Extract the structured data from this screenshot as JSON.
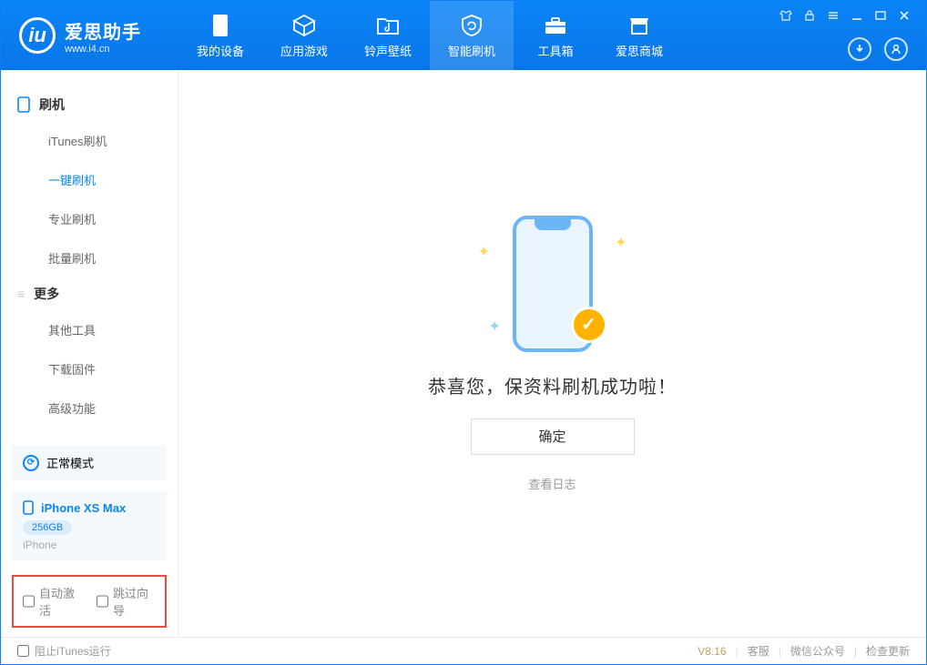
{
  "app": {
    "title": "爱思助手",
    "subtitle": "www.i4.cn"
  },
  "nav": {
    "tabs": [
      {
        "label": "我的设备"
      },
      {
        "label": "应用游戏"
      },
      {
        "label": "铃声壁纸"
      },
      {
        "label": "智能刷机"
      },
      {
        "label": "工具箱"
      },
      {
        "label": "爱思商城"
      }
    ]
  },
  "sidebar": {
    "section1": {
      "title": "刷机",
      "items": [
        "iTunes刷机",
        "一键刷机",
        "专业刷机",
        "批量刷机"
      ],
      "active_index": 1
    },
    "section2": {
      "title": "更多",
      "items": [
        "其他工具",
        "下载固件",
        "高级功能"
      ]
    },
    "mode_card": {
      "label": "正常模式"
    },
    "device": {
      "name": "iPhone XS Max",
      "storage": "256GB",
      "type": "iPhone"
    },
    "checks": {
      "auto_activate": "自动激活",
      "skip_guide": "跳过向导"
    }
  },
  "main": {
    "success_text": "恭喜您，保资料刷机成功啦！",
    "ok_label": "确定",
    "log_link": "查看日志"
  },
  "footer": {
    "block_itunes": "阻止iTunes运行",
    "version": "V8.16",
    "links": [
      "客服",
      "微信公众号",
      "检查更新"
    ]
  }
}
